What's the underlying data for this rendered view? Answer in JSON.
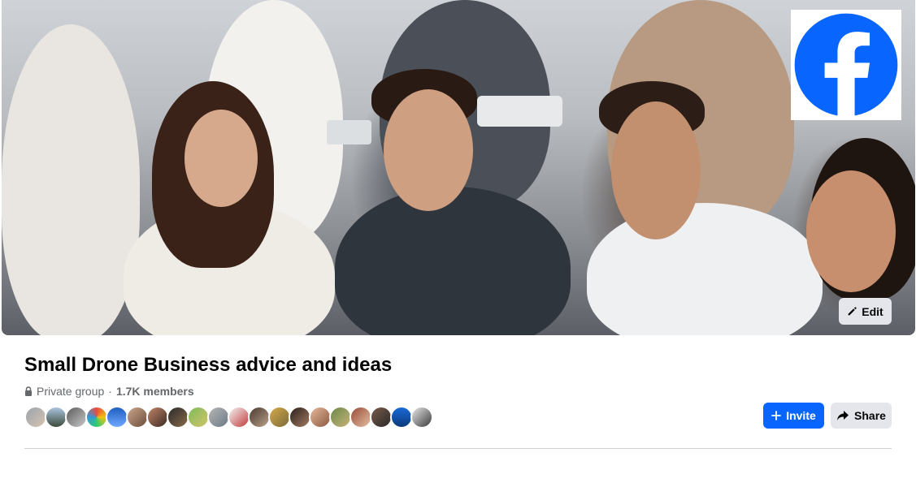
{
  "cover": {
    "edit_label": "Edit"
  },
  "logo": {
    "icon": "facebook-logo",
    "color": "#0866ff"
  },
  "group": {
    "title": "Small Drone Business advice and ideas",
    "privacy": "Private group",
    "separator": "·",
    "members": "1.7K members"
  },
  "actions": {
    "invite_label": "Invite",
    "share_label": "Share"
  },
  "colors": {
    "primary_button": "#0866ff",
    "secondary_button": "#e4e6eb",
    "secondary_text": "#65676b"
  }
}
